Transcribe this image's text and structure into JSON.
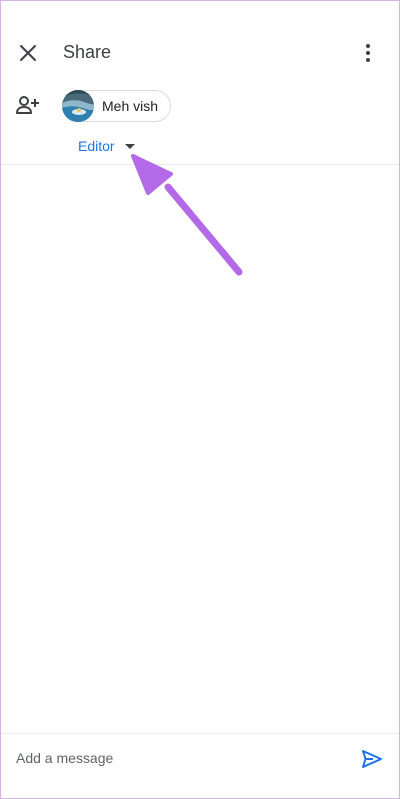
{
  "header": {
    "title": "Share",
    "close_icon": "close-icon",
    "more_icon": "more-vert-icon"
  },
  "recipients": {
    "add_icon": "person-add-icon",
    "chips": [
      {
        "name": "Meh vish",
        "avatar": "profile-photo"
      }
    ]
  },
  "role": {
    "selected": "Editor"
  },
  "message": {
    "placeholder": "Add a message",
    "value": "",
    "send_icon": "send-icon"
  },
  "colors": {
    "accent": "#1a73e8",
    "annotation_arrow": "#b469e8",
    "text_primary": "#202124",
    "text_secondary": "#5f6368"
  }
}
